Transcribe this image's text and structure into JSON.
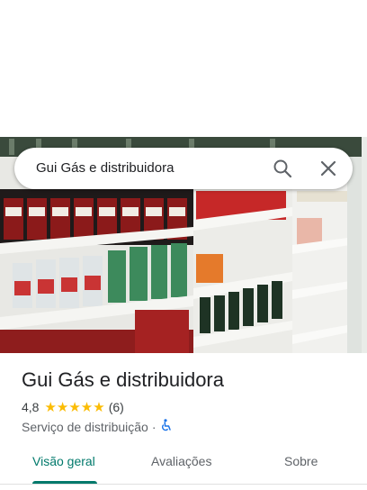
{
  "search": {
    "query": "Gui Gás e distribuidora"
  },
  "place": {
    "name": "Gui Gás e distribuidora",
    "rating": "4,8",
    "stars": "★★★★★",
    "review_count": "(6)",
    "category": "Serviço de distribuição",
    "separator": "·"
  },
  "tabs": [
    {
      "label": "Visão geral",
      "active": true
    },
    {
      "label": "Avaliações",
      "active": false
    },
    {
      "label": "Sobre",
      "active": false
    }
  ],
  "colors": {
    "accent": "#00796b",
    "star": "#fbbc04",
    "link": "#1a73e8"
  },
  "icons": {
    "search": "search-icon",
    "close": "close-icon",
    "accessibility": "wheelchair-icon"
  }
}
